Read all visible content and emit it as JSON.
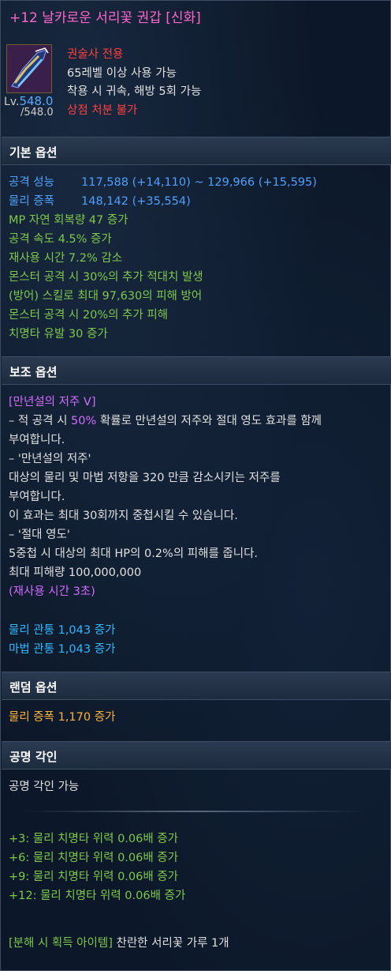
{
  "item": {
    "title": "+12 날카로운 서리꽃 권갑 [신화]",
    "class_only": "권술사 전용",
    "level_req": "65레벨 이상 사용 가능",
    "bind": "착용 시 귀속, 해방 5회 가능",
    "shop": "상점 처분 불가",
    "lv_label": "Lv.",
    "lv_value": "548.0",
    "lv_max": "/548.0",
    "icon": "gauntlet-icon"
  },
  "basic": {
    "header": "기본 옵션",
    "attack_label": "공격 성능",
    "attack_value": "117,588 (+14,110) ~ 129,966 (+15,595)",
    "amp_label": "물리 증폭",
    "amp_value": "148,142 (+35,554)",
    "lines": [
      "MP 자연 회복량 47 증가",
      "공격 속도 4.5% 증가",
      "재사용 시간 7.2% 감소",
      "몬스터 공격 시 30%의 추가 적대치 발생",
      "(방어) 스킬로 최대 97,630의 피해 방어",
      "몬스터 공격 시 20%의 추가 피해",
      "치명타 유발 30 증가"
    ]
  },
  "sub": {
    "header": "보조 옵션",
    "curse_title": "[만년설의 저주 V]",
    "desc1_a": "– 적 공격 시 ",
    "desc1_pct": "50%",
    "desc1_b": " 확률로 만년설의 저주와 절대 영도 효과를 함께",
    "desc2": "부여합니다.",
    "desc3": "– '만년설의 저주'",
    "desc4": "대상의 물리 및 마법 저항을 320 만큼 감소시키는 저주를",
    "desc5": "부여합니다.",
    "desc6": "이 효과는 최대 30회까지 중첩시킬 수 있습니다.",
    "desc7": "– '절대 영도'",
    "desc8": "5중첩 시 대상의 최대 HP의 0.2%의 피해를 줍니다.",
    "desc9": "최대 피해량 100,000,000",
    "cooldown": "(재사용 시간 3초)",
    "pen1": "물리 관통 1,043 증가",
    "pen2": "마법 관통 1,043 증가"
  },
  "random": {
    "header": "랜덤 옵션",
    "line": "물리 증폭 1,170 증가"
  },
  "engrave": {
    "header": "공명 각인",
    "status": "공명 각인 가능",
    "lines": [
      "+3: 물리 치명타 위력 0.06배 증가",
      "+6: 물리 치명타 위력 0.06배 증가",
      "+9: 물리 치명타 위력 0.06배 증가",
      "+12: 물리 치명타 위력 0.06배 증가"
    ],
    "disassemble_label": "[분해 시 획득 아이템]",
    "disassemble_item": " 찬란한 서리꽃 가루 1개"
  },
  "colors": {
    "title": "#ff66cc",
    "blue": "#4fa0ff",
    "green": "#7ec84a",
    "violet": "#d36bff",
    "cyan": "#2fb8ff",
    "orange": "#ffb23a",
    "red": "#ff4040"
  }
}
